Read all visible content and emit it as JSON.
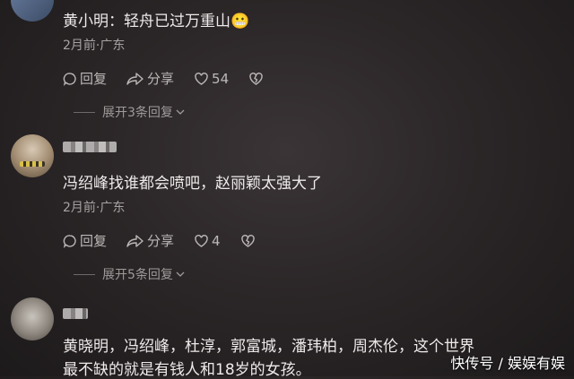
{
  "comments": [
    {
      "user": "黄小明",
      "text": "黄小明：轻舟已过万重山😬",
      "meta": "2月前·广东",
      "reply_label": "回复",
      "share_label": "分享",
      "likes": "54",
      "expand_label": "展开3条回复"
    },
    {
      "text": "冯绍峰找谁都会喷吧，赵丽颖太强大了",
      "meta": "2月前·广东",
      "reply_label": "回复",
      "share_label": "分享",
      "likes": "4",
      "expand_label": "展开5条回复"
    },
    {
      "text_line1": "黄晓明，冯绍峰，杜淳，郭富城，潘玮柏，周杰伦，这个世界",
      "text_line2": "最不缺的就是有钱人和18岁的女孩。"
    }
  ],
  "watermark": "快传号 / 娱娱有娱",
  "colors": {
    "background": "#2b2627",
    "text": "#eeeaea",
    "meta": "#a7a2a2"
  }
}
